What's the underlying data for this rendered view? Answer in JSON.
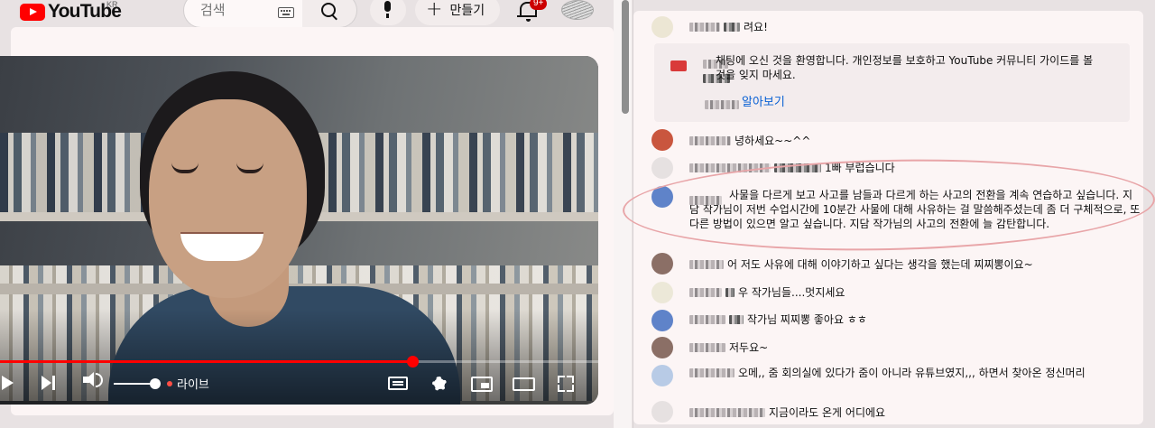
{
  "header": {
    "logo_text": "YouTube",
    "country_code": "KR",
    "search_placeholder": "검색",
    "create_label": "만들기",
    "notification_count": "9+"
  },
  "player": {
    "live_label": "라이브",
    "progress_fraction": 0.69
  },
  "chat": {
    "messages": [
      {
        "id": 1,
        "text": "려요!"
      },
      {
        "id": 2,
        "text": "녕하세요~~^^"
      },
      {
        "id": 3,
        "text": "1빠 부럽습니다"
      },
      {
        "id": 4,
        "text": "사물을 다르게 보고 사고를 남들과 다르게 하는 사고의 전환을 계속 연습하고 싶습니다. 지담 작가님이 저번 수업시간에 10분간 사물에 대해 사유하는 걸 말씀해주셨는데 좀 더 구체적으로, 또 다른 방법이 있으면 알고 싶습니다. 지담 작가님의 사고의 전환에 늘 감탄합니다."
      },
      {
        "id": 5,
        "text": "어 저도 사유에 대해 이야기하고 싶다는 생각을 했는데 찌찌뽕이요~"
      },
      {
        "id": 6,
        "text": "우 작가님들....멋지세요"
      },
      {
        "id": 7,
        "text": "작가님 찌찌뽕 좋아요 ㅎㅎ"
      },
      {
        "id": 8,
        "text": "저두요~"
      },
      {
        "id": 9,
        "text": "오메,, 줌 회의실에 있다가 줌이 아니라 유튜브였지,,, 하면서 찾아온 정신머리"
      },
      {
        "id": 10,
        "text": "지금이라도 온게 어디에요"
      }
    ],
    "welcome": {
      "text": "채팅에 오신 것을 환영합니다. 개인정보를 보호하고 YouTube 커뮤니티 가이드를 볼 것을 잊지 마세요.",
      "learn_more": "알아보기"
    }
  },
  "colors": {
    "accent_red": "#ff0000",
    "link_blue": "#065fd4",
    "highlight_ring": "#e8a5a8"
  },
  "icons": [
    "youtube-logo-icon",
    "keyboard-icon",
    "search-icon",
    "mic-icon",
    "plus-icon",
    "bell-icon",
    "account-icon",
    "play-icon",
    "next-icon",
    "volume-icon",
    "subtitles-icon",
    "settings-icon",
    "miniplayer-icon",
    "theater-icon",
    "fullscreen-icon"
  ]
}
